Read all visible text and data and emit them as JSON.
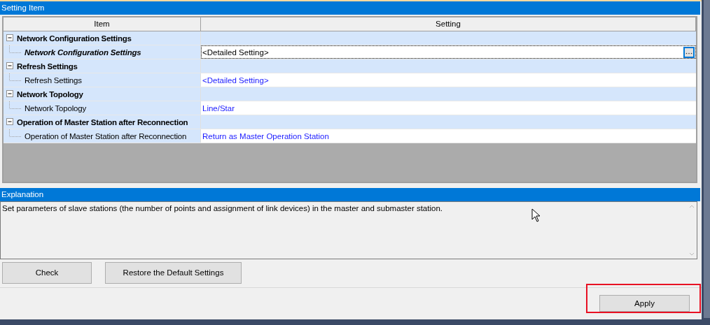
{
  "setting_item": {
    "title": "Setting Item",
    "columns": [
      "Item",
      "Setting"
    ],
    "groups": [
      {
        "name": "Network Configuration Settings",
        "expanded": true,
        "children": [
          {
            "label": "Network Configuration Settings",
            "value": "<Detailed Setting>",
            "selected": true
          }
        ]
      },
      {
        "name": "Refresh Settings",
        "expanded": true,
        "children": [
          {
            "label": "Refresh Settings",
            "value": "<Detailed Setting>",
            "selected": false
          }
        ]
      },
      {
        "name": "Network Topology",
        "expanded": true,
        "children": [
          {
            "label": "Network Topology",
            "value": "Line/Star",
            "selected": false
          }
        ]
      },
      {
        "name": "Operation of Master Station after Reconnection",
        "expanded": true,
        "children": [
          {
            "label": "Operation of Master Station after Reconnection",
            "value": "Return as Master Operation Station",
            "selected": false
          }
        ]
      }
    ]
  },
  "explanation": {
    "title": "Explanation",
    "text": "Set parameters of slave stations (the number of points and assignment of link devices) in the master and submaster station."
  },
  "buttons": [
    "Check",
    "Restore the Default Settings"
  ],
  "apply": {
    "label": "Apply",
    "highlighted": true
  }
}
